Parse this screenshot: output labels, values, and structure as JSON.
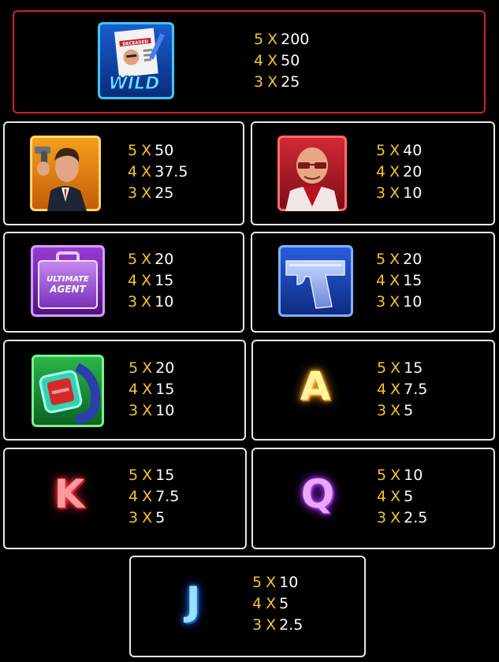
{
  "paytable": [
    {
      "symbol": "WILD",
      "icon": "wild-id-badge-icon",
      "pays": [
        {
          "count": "5",
          "value": "200"
        },
        {
          "count": "4",
          "value": "50"
        },
        {
          "count": "3",
          "value": "25"
        }
      ]
    },
    {
      "symbol": "agent",
      "icon": "secret-agent-icon",
      "pays": [
        {
          "count": "5",
          "value": "50"
        },
        {
          "count": "4",
          "value": "37.5"
        },
        {
          "count": "3",
          "value": "25"
        }
      ]
    },
    {
      "symbol": "villain",
      "icon": "bald-villain-icon",
      "pays": [
        {
          "count": "5",
          "value": "40"
        },
        {
          "count": "4",
          "value": "20"
        },
        {
          "count": "3",
          "value": "10"
        }
      ]
    },
    {
      "symbol": "briefcase",
      "icon": "briefcase-icon",
      "pays": [
        {
          "count": "5",
          "value": "20"
        },
        {
          "count": "4",
          "value": "15"
        },
        {
          "count": "3",
          "value": "10"
        }
      ]
    },
    {
      "symbol": "pistol",
      "icon": "pistol-icon",
      "pays": [
        {
          "count": "5",
          "value": "20"
        },
        {
          "count": "4",
          "value": "15"
        },
        {
          "count": "3",
          "value": "10"
        }
      ]
    },
    {
      "symbol": "watch",
      "icon": "spy-watch-icon",
      "pays": [
        {
          "count": "5",
          "value": "20"
        },
        {
          "count": "4",
          "value": "15"
        },
        {
          "count": "3",
          "value": "10"
        }
      ]
    },
    {
      "symbol": "A",
      "icon": "letter-a-icon",
      "pays": [
        {
          "count": "5",
          "value": "15"
        },
        {
          "count": "4",
          "value": "7.5"
        },
        {
          "count": "3",
          "value": "5"
        }
      ]
    },
    {
      "symbol": "K",
      "icon": "letter-k-icon",
      "pays": [
        {
          "count": "5",
          "value": "15"
        },
        {
          "count": "4",
          "value": "7.5"
        },
        {
          "count": "3",
          "value": "5"
        }
      ]
    },
    {
      "symbol": "Q",
      "icon": "letter-q-icon",
      "pays": [
        {
          "count": "5",
          "value": "10"
        },
        {
          "count": "4",
          "value": "5"
        },
        {
          "count": "3",
          "value": "2.5"
        }
      ]
    },
    {
      "symbol": "J",
      "icon": "letter-j-icon",
      "pays": [
        {
          "count": "5",
          "value": "10"
        },
        {
          "count": "4",
          "value": "5"
        },
        {
          "count": "3",
          "value": "2.5"
        }
      ]
    }
  ],
  "icon_text": {
    "wild": "WILD",
    "badge": "DECEASED",
    "briefcase_line1": "ULTIMATE",
    "briefcase_line2": "AGENT"
  },
  "separator": "X",
  "colors": {
    "multiplier": "#f6c22a",
    "payout": "#ffffff",
    "panel_border": "#e8e8e8",
    "wild_border": "#d4202a",
    "background": "#000000"
  }
}
